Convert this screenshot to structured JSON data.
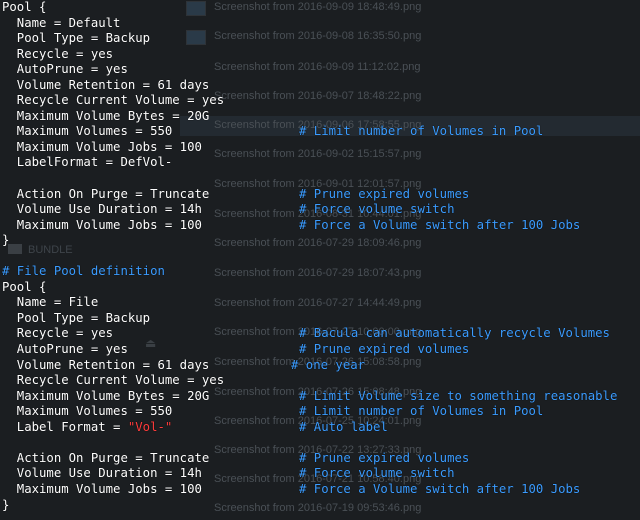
{
  "background": {
    "files": [
      "Screenshot from 2016-09-09 18:48:49.png",
      "Screenshot from 2016-09-08 16:35:50.png",
      "Screenshot from 2016-09-09 11:12:02.png",
      "Screenshot from 2016-09-07 18:48:22.png",
      "Screenshot from 2016-09-06 17:58:55.png",
      "Screenshot from 2016-09-02 15:15:57.png",
      "Screenshot from 2016-09-01 12:01:57.png",
      "Screenshot from 2016-08-31 10:44:01.png",
      "Screenshot from 2016-07-29 18:09:46.png",
      "Screenshot from 2016-07-29 18:07:43.png",
      "Screenshot from 2016-07-27 14:44:49.png",
      "Screenshot from 2016-07-27 10:00:00.png",
      "Screenshot from 2016-07-26 15:08:58.png",
      "Screenshot from 2016-07-26 15:08:48.png",
      "Screenshot from 2016-07-25 10:24:01.png",
      "Screenshot from 2016-07-22 13:27:33.png",
      "Screenshot from 2016-07-21 10:58:40.png",
      "Screenshot from 2016-07-19 09:53:46.png"
    ],
    "folder_label": "BUNDLE"
  },
  "colors": {
    "background": "#1b1e21",
    "text": "#ffffff",
    "comment": "#3b9cff",
    "string": "#ff3c3c"
  },
  "terminal": {
    "block1": {
      "open": "Pool {",
      "lines": [
        "  Name = Default",
        "  Pool Type = Backup",
        "  Recycle = yes",
        "  AutoPrune = yes",
        "  Volume Retention = 61 days",
        "  Recycle Current Volume = yes",
        "  Maximum Volume Bytes = 20G"
      ],
      "max_volumes": "  Maximum Volumes = 550",
      "max_volumes_comment": "# Limit number of Volumes in Pool",
      "max_jobs": "  Maximum Volume Jobs = 100",
      "label_format": "  LabelFormat = DefVol-",
      "purge": "  Action On Purge = Truncate",
      "purge_comment": "# Prune expired volumes",
      "duration": "  Volume Use Duration = 14h",
      "duration_comment": "# Force volume switch",
      "max_jobs2": "  Maximum Volume Jobs = 100",
      "max_jobs2_comment": "# Force a Volume switch after 100 Jobs",
      "close": "}"
    },
    "block2": {
      "heading": "# File Pool definition",
      "open": "Pool {",
      "name": "  Name = File",
      "type": "  Pool Type = Backup",
      "recycle": "  Recycle = yes",
      "recycle_comment": "# Bacula can automatically recycle Volumes",
      "autoprune": "  AutoPrune = yes",
      "autoprune_comment": "# Prune expired volumes",
      "retention": "  Volume Retention = 61 days",
      "retention_comment": "# one year",
      "recycle_current": "  Recycle Current Volume = yes",
      "max_bytes": "  Maximum Volume Bytes = 20G",
      "max_bytes_comment": "# Limit Volume size to something reasonable",
      "max_volumes": "  Maximum Volumes = 550",
      "max_volumes_comment": "# Limit number of Volumes in Pool",
      "label_format_key": "  Label Format = ",
      "label_format_value": "\"Vol-\"",
      "label_format_comment": "# Auto label",
      "purge": "  Action On Purge = Truncate",
      "purge_comment": "# Prune expired volumes",
      "duration": "  Volume Use Duration = 14h",
      "duration_comment": "# Force volume switch",
      "max_jobs": "  Maximum Volume Jobs = 100",
      "max_jobs_comment": "# Force a Volume switch after 100 Jobs",
      "close": "}"
    }
  }
}
